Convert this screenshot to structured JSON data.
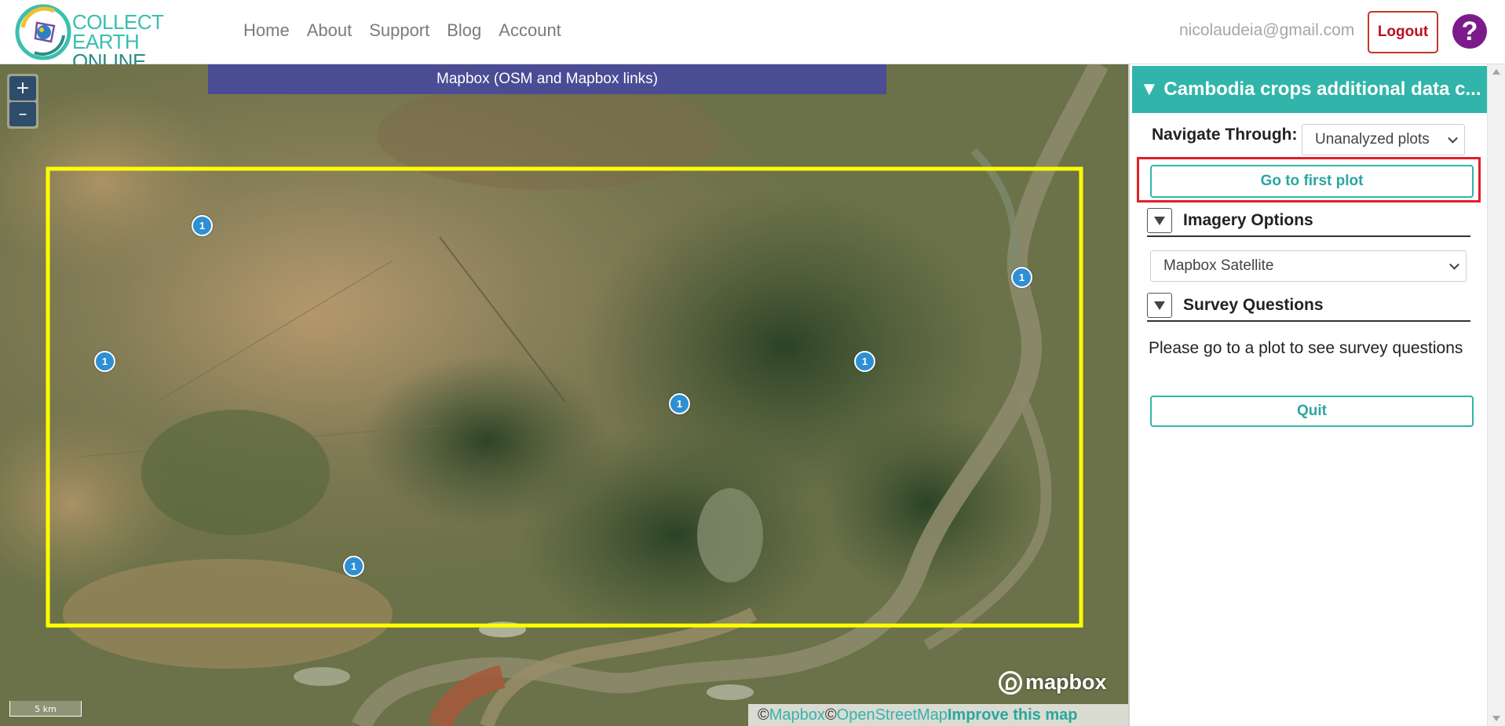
{
  "brand": {
    "line1": "COLLECT EARTH",
    "line2": "ONLINE",
    "logo_icon": "collect-earth-globe-icon"
  },
  "nav": {
    "items": [
      "Home",
      "About",
      "Support",
      "Blog",
      "Account"
    ]
  },
  "user": {
    "email": "nicolaudeia@gmail.com",
    "logout_label": "Logout",
    "help_label": "?"
  },
  "map": {
    "imagery_banner": "Mapbox (OSM and Mapbox links)",
    "zoom_in": "+",
    "zoom_out": "–",
    "plot_markers": [
      "1",
      "1",
      "1",
      "1",
      "1",
      "1"
    ],
    "scale_label": "5 km",
    "mapbox_logo": "mapbox",
    "attribution": {
      "copy1": "© ",
      "mapbox": "Mapbox",
      "copy2": "© ",
      "osm": "OpenStreetMap",
      "improve": "Improve this map"
    },
    "colors": {
      "boundary": "#ffff00",
      "marker": "#2d8fd4"
    }
  },
  "panel": {
    "title": "▼ Cambodia crops additional data c...",
    "navigate_label": "Navigate Through:",
    "navigate_value": "Unanalyzed plots",
    "first_plot_button": "Go to first plot",
    "imagery_section": "Imagery Options",
    "imagery_value": "Mapbox Satellite",
    "survey_section": "Survey Questions",
    "survey_message": "Please go to a plot to see survey questions",
    "quit_button": "Quit",
    "colors": {
      "accent": "#31b5aa",
      "highlight": "#e02027"
    }
  }
}
